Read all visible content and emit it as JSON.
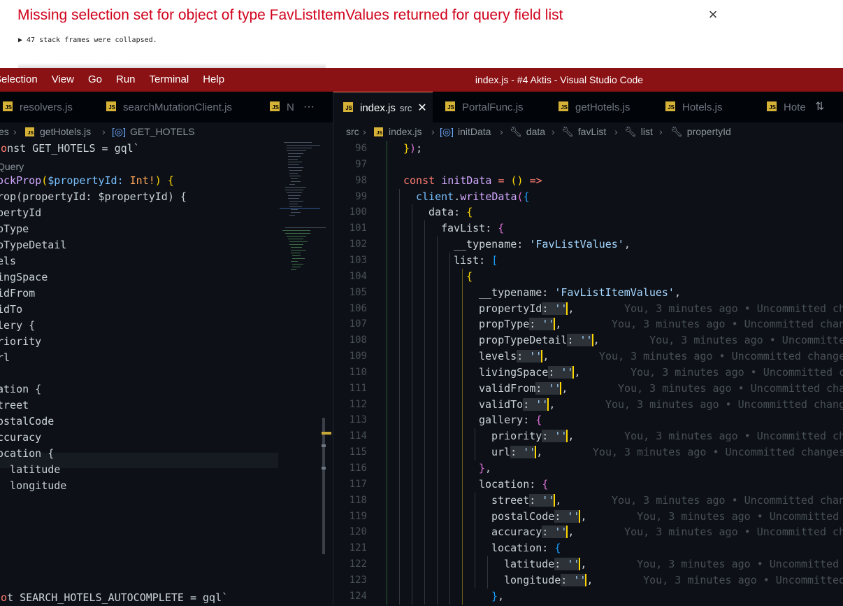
{
  "error_overlay": {
    "message": "Missing selection set for object of type FavListItemValues returned for query field list",
    "close": "×",
    "frames": "▶ 47 stack frames were collapsed."
  },
  "titlebar": {
    "menu": [
      "Selection",
      "View",
      "Go",
      "Run",
      "Terminal",
      "Help"
    ],
    "title": "index.js - #4 Aktis - Visual Studio Code"
  },
  "left_group": {
    "tabs": [
      "resolvers.js",
      "searchMutationClient.js",
      "N"
    ],
    "more": "···",
    "breadcrumb": [
      "es",
      "getHotels.js",
      "GET_HOTELS"
    ],
    "lines": [
      "const GET_HOTELS = gql`",
      "Query",
      "ockProp($propertyId: Int!) {",
      "rop(propertyId: $propertyId) {",
      "pertyId",
      "pType",
      "pTypeDetail",
      "els",
      "ingSpace",
      "idFrom",
      "idTo",
      "lery {",
      "riority",
      "rl",
      "",
      "ation {",
      "treet",
      "ostalCode",
      "ccuracy",
      "ocation {",
      "  latitude",
      "  longitude",
      "",
      "",
      "",
      "",
      "",
      "",
      "nst SEARCH_HOTELS_AUTOCOMPLETE = gql`"
    ]
  },
  "right_group": {
    "tabs": [
      {
        "file": "index.js",
        "sub": "src",
        "close": "✕"
      },
      {
        "file": "PortalFunc.js"
      },
      {
        "file": "getHotels.js"
      },
      {
        "file": "Hotels.js"
      },
      {
        "file": "Hote"
      }
    ],
    "breadcrumb": [
      "src",
      "index.js",
      "initData",
      "data",
      "favList",
      "list",
      "propertyId"
    ],
    "line_numbers": [
      "96",
      "97",
      "98",
      "99",
      "100",
      "101",
      "102",
      "103",
      "104",
      "105",
      "106",
      "107",
      "108",
      "109",
      "110",
      "111",
      "112",
      "113",
      "114",
      "115",
      "116",
      "117",
      "118",
      "119",
      "120",
      "121",
      "122",
      "123",
      "124"
    ],
    "code": {
      "l96": "});",
      "l98_kw": "const",
      "l98_name": "initData",
      "l98_rest": " = () =>",
      "l99_obj": "client",
      "l99_fn": "writeData",
      "l100": "data: ",
      "l101": "favList: ",
      "l102_key": "__typename: ",
      "l102_val": "'FavListValues'",
      "l103": "list: ",
      "l105_key": "__typename: ",
      "l105_val": "'FavListItemValues'",
      "fields": [
        {
          "key": "propertyId",
          "blame": "You, 3 minutes ago • Uncommitted ch"
        },
        {
          "key": "propType",
          "blame": "You, 3 minutes ago • Uncommitted chan"
        },
        {
          "key": "propTypeDetail",
          "blame": "You, 3 minutes ago • Uncommitte"
        },
        {
          "key": "levels",
          "blame": "You, 3 minutes ago • Uncommitted change"
        },
        {
          "key": "livingSpace",
          "blame": "You, 3 minutes ago • Uncommitted c"
        },
        {
          "key": "validFrom",
          "blame": "You, 3 minutes ago • Uncommitted cha"
        },
        {
          "key": "validTo",
          "blame": "You, 3 minutes ago • Uncommitted chang"
        }
      ],
      "gallery": "gallery: ",
      "gallery_fields": [
        {
          "key": "priority",
          "blame": "You, 3 minutes ago • Uncommitted ch"
        },
        {
          "key": "url",
          "blame": "You, 3 minutes ago • Uncommitted changes"
        }
      ],
      "location": "location: ",
      "location_fields": [
        {
          "key": "street",
          "blame": "You, 3 minutes ago • Uncommitted chan"
        },
        {
          "key": "postalCode",
          "blame": "You, 3 minutes ago • Uncommitted"
        },
        {
          "key": "accuracy",
          "blame": "You, 3 minutes ago • Uncommitted ch"
        }
      ],
      "inner_location": "location: ",
      "inner_fields": [
        {
          "key": "latitude",
          "blame": "You, 3 minutes ago • Uncommitted"
        },
        {
          "key": "longitude",
          "blame": "You, 3 minutes ago • Uncommitted"
        }
      ],
      "empty_value": "''"
    }
  }
}
